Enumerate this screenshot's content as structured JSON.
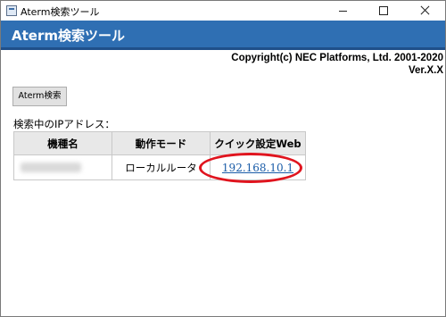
{
  "window": {
    "title": "Aterm検索ツール"
  },
  "header": {
    "title": "Aterm検索ツール",
    "accent_color": "#2f6fb3"
  },
  "info": {
    "copyright": "Copyright(c) NEC Platforms, Ltd. 2001-2020",
    "version": "Ver.X.X"
  },
  "toolbar": {
    "search_label": "Aterm検索"
  },
  "results": {
    "label": "検索中のIPアドレス：",
    "columns": [
      "機種名",
      "動作モード",
      "クイック設定Web"
    ],
    "rows": [
      {
        "model": "",
        "mode": "ローカルルータ",
        "web": "192.168.10.1"
      }
    ]
  },
  "icons": {
    "app": "app-icon",
    "minimize": "minimize-icon",
    "maximize": "maximize-icon",
    "close": "close-icon"
  },
  "annotation": {
    "highlight_color": "#e0141e"
  }
}
